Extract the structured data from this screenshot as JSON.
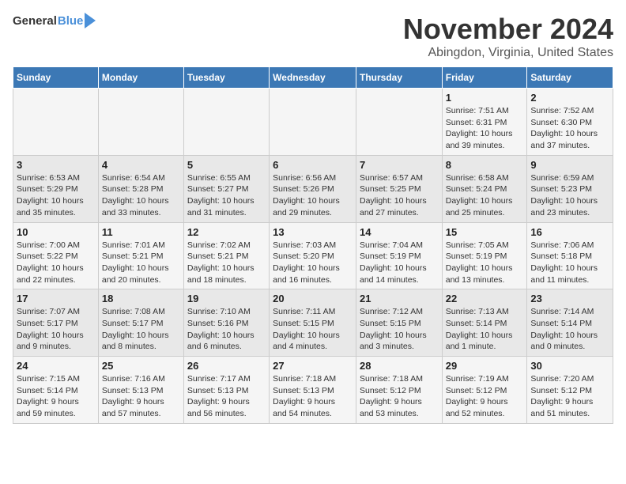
{
  "header": {
    "logo_general": "General",
    "logo_blue": "Blue",
    "title": "November 2024",
    "subtitle": "Abingdon, Virginia, United States"
  },
  "columns": [
    "Sunday",
    "Monday",
    "Tuesday",
    "Wednesday",
    "Thursday",
    "Friday",
    "Saturday"
  ],
  "weeks": [
    {
      "days": [
        {
          "num": "",
          "detail": ""
        },
        {
          "num": "",
          "detail": ""
        },
        {
          "num": "",
          "detail": ""
        },
        {
          "num": "",
          "detail": ""
        },
        {
          "num": "",
          "detail": ""
        },
        {
          "num": "1",
          "detail": "Sunrise: 7:51 AM\nSunset: 6:31 PM\nDaylight: 10 hours\nand 39 minutes."
        },
        {
          "num": "2",
          "detail": "Sunrise: 7:52 AM\nSunset: 6:30 PM\nDaylight: 10 hours\nand 37 minutes."
        }
      ]
    },
    {
      "days": [
        {
          "num": "3",
          "detail": "Sunrise: 6:53 AM\nSunset: 5:29 PM\nDaylight: 10 hours\nand 35 minutes."
        },
        {
          "num": "4",
          "detail": "Sunrise: 6:54 AM\nSunset: 5:28 PM\nDaylight: 10 hours\nand 33 minutes."
        },
        {
          "num": "5",
          "detail": "Sunrise: 6:55 AM\nSunset: 5:27 PM\nDaylight: 10 hours\nand 31 minutes."
        },
        {
          "num": "6",
          "detail": "Sunrise: 6:56 AM\nSunset: 5:26 PM\nDaylight: 10 hours\nand 29 minutes."
        },
        {
          "num": "7",
          "detail": "Sunrise: 6:57 AM\nSunset: 5:25 PM\nDaylight: 10 hours\nand 27 minutes."
        },
        {
          "num": "8",
          "detail": "Sunrise: 6:58 AM\nSunset: 5:24 PM\nDaylight: 10 hours\nand 25 minutes."
        },
        {
          "num": "9",
          "detail": "Sunrise: 6:59 AM\nSunset: 5:23 PM\nDaylight: 10 hours\nand 23 minutes."
        }
      ]
    },
    {
      "days": [
        {
          "num": "10",
          "detail": "Sunrise: 7:00 AM\nSunset: 5:22 PM\nDaylight: 10 hours\nand 22 minutes."
        },
        {
          "num": "11",
          "detail": "Sunrise: 7:01 AM\nSunset: 5:21 PM\nDaylight: 10 hours\nand 20 minutes."
        },
        {
          "num": "12",
          "detail": "Sunrise: 7:02 AM\nSunset: 5:21 PM\nDaylight: 10 hours\nand 18 minutes."
        },
        {
          "num": "13",
          "detail": "Sunrise: 7:03 AM\nSunset: 5:20 PM\nDaylight: 10 hours\nand 16 minutes."
        },
        {
          "num": "14",
          "detail": "Sunrise: 7:04 AM\nSunset: 5:19 PM\nDaylight: 10 hours\nand 14 minutes."
        },
        {
          "num": "15",
          "detail": "Sunrise: 7:05 AM\nSunset: 5:19 PM\nDaylight: 10 hours\nand 13 minutes."
        },
        {
          "num": "16",
          "detail": "Sunrise: 7:06 AM\nSunset: 5:18 PM\nDaylight: 10 hours\nand 11 minutes."
        }
      ]
    },
    {
      "days": [
        {
          "num": "17",
          "detail": "Sunrise: 7:07 AM\nSunset: 5:17 PM\nDaylight: 10 hours\nand 9 minutes."
        },
        {
          "num": "18",
          "detail": "Sunrise: 7:08 AM\nSunset: 5:17 PM\nDaylight: 10 hours\nand 8 minutes."
        },
        {
          "num": "19",
          "detail": "Sunrise: 7:10 AM\nSunset: 5:16 PM\nDaylight: 10 hours\nand 6 minutes."
        },
        {
          "num": "20",
          "detail": "Sunrise: 7:11 AM\nSunset: 5:15 PM\nDaylight: 10 hours\nand 4 minutes."
        },
        {
          "num": "21",
          "detail": "Sunrise: 7:12 AM\nSunset: 5:15 PM\nDaylight: 10 hours\nand 3 minutes."
        },
        {
          "num": "22",
          "detail": "Sunrise: 7:13 AM\nSunset: 5:14 PM\nDaylight: 10 hours\nand 1 minute."
        },
        {
          "num": "23",
          "detail": "Sunrise: 7:14 AM\nSunset: 5:14 PM\nDaylight: 10 hours\nand 0 minutes."
        }
      ]
    },
    {
      "days": [
        {
          "num": "24",
          "detail": "Sunrise: 7:15 AM\nSunset: 5:14 PM\nDaylight: 9 hours\nand 59 minutes."
        },
        {
          "num": "25",
          "detail": "Sunrise: 7:16 AM\nSunset: 5:13 PM\nDaylight: 9 hours\nand 57 minutes."
        },
        {
          "num": "26",
          "detail": "Sunrise: 7:17 AM\nSunset: 5:13 PM\nDaylight: 9 hours\nand 56 minutes."
        },
        {
          "num": "27",
          "detail": "Sunrise: 7:18 AM\nSunset: 5:13 PM\nDaylight: 9 hours\nand 54 minutes."
        },
        {
          "num": "28",
          "detail": "Sunrise: 7:18 AM\nSunset: 5:12 PM\nDaylight: 9 hours\nand 53 minutes."
        },
        {
          "num": "29",
          "detail": "Sunrise: 7:19 AM\nSunset: 5:12 PM\nDaylight: 9 hours\nand 52 minutes."
        },
        {
          "num": "30",
          "detail": "Sunrise: 7:20 AM\nSunset: 5:12 PM\nDaylight: 9 hours\nand 51 minutes."
        }
      ]
    }
  ]
}
